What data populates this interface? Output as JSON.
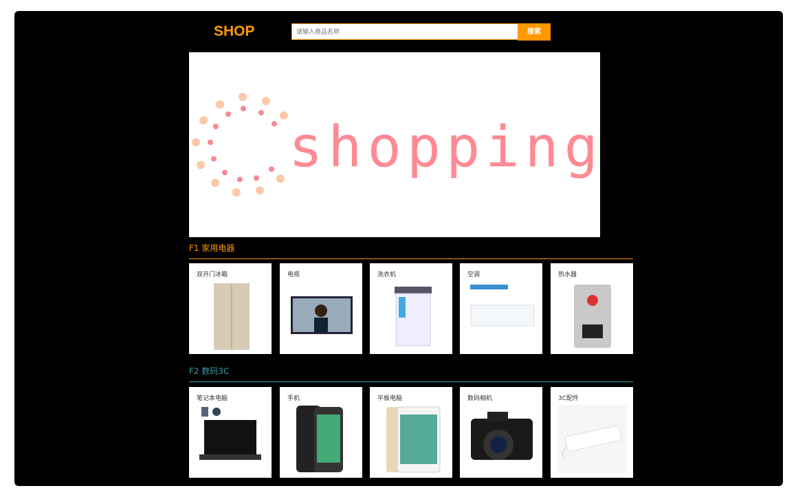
{
  "header": {
    "logo": "SHOP",
    "search_placeholder": "请输入商品名称",
    "search_button": "搜索"
  },
  "banner": {
    "text": "shopping"
  },
  "floors": [
    {
      "title": "F1 家用电器",
      "color": "#f90",
      "items": [
        {
          "name": "双开门冰箱"
        },
        {
          "name": "电视"
        },
        {
          "name": "洗衣机"
        },
        {
          "name": "空调"
        },
        {
          "name": "热水器"
        }
      ]
    },
    {
      "title": "F2 数码3C",
      "color": "#3a9ea5",
      "items": [
        {
          "name": "笔记本电脑"
        },
        {
          "name": "手机"
        },
        {
          "name": "平板电脑"
        },
        {
          "name": "数码相机"
        },
        {
          "name": "3C配件"
        }
      ]
    }
  ]
}
